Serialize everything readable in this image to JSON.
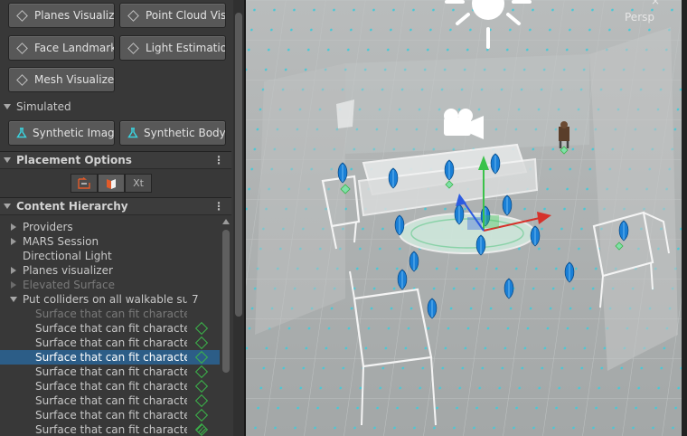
{
  "inspector": {
    "buttons_row1": [
      "Planes Visualiz",
      "Point Cloud Vis"
    ],
    "buttons_row2": [
      "Face Landmark",
      "Light Estimatio"
    ],
    "buttons_row3": [
      "Mesh Visualize"
    ],
    "simulated_label": "Simulated",
    "simulated_buttons": [
      "Synthetic Imag",
      "Synthetic Body"
    ],
    "placement_options": "Placement Options",
    "content_hierarchy": "Content Hierarchy",
    "kebab": "⋮",
    "tool_xt_label": "Xt"
  },
  "hierarchy": {
    "items": [
      {
        "label": "Providers",
        "expandable": true
      },
      {
        "label": "MARS Session",
        "expandable": true
      },
      {
        "label": "Directional Light",
        "expandable": false
      },
      {
        "label": "Planes visualizer",
        "expandable": true
      },
      {
        "label": "Elevated Surface",
        "expandable": true,
        "dimmed": true
      },
      {
        "label": "Put colliders on all walkable surf",
        "expanded": true,
        "count": "7"
      }
    ],
    "children": [
      {
        "label": "Surface that can fit character",
        "dimmed": true,
        "icon": "none"
      },
      {
        "label": "Surface that can fit character(",
        "icon": "green-diamond"
      },
      {
        "label": "Surface that can fit character(",
        "icon": "green-diamond"
      },
      {
        "label": "Surface that can fit character(",
        "icon": "green-diamond",
        "selected": true
      },
      {
        "label": "Surface that can fit character(",
        "icon": "green-diamond"
      },
      {
        "label": "Surface that can fit character(",
        "icon": "green-diamond"
      },
      {
        "label": "Surface that can fit character(",
        "icon": "green-diamond"
      },
      {
        "label": "Surface that can fit character(",
        "icon": "green-diamond"
      },
      {
        "label": "Surface that can fit character(",
        "icon": "green-diamond-striped"
      }
    ]
  },
  "scene": {
    "persp_label": "Persp",
    "close_glyph": "×",
    "accent_cyan": "#3ad4e0",
    "marker_blue": "#1a7fd6",
    "axis_x_color": "#d6312a",
    "axis_y_color": "#3ac24a",
    "axis_z_color": "#2c5be0",
    "selection_color": "#2c5d87"
  }
}
